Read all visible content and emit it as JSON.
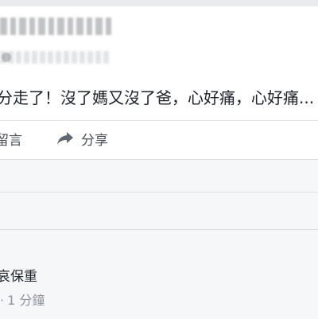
{
  "post": {
    "text": "分走了！沒了媽又沒了爸，心好痛，心好痛...",
    "actions": {
      "comment": "留言",
      "share": "分享"
    }
  },
  "comment": {
    "text": "哀保重",
    "time": "1 分鐘"
  },
  "colors": {
    "background": "#e9ebee",
    "card": "#ffffff",
    "muted_text": "#90949c",
    "action_text": "#4b4f56"
  }
}
